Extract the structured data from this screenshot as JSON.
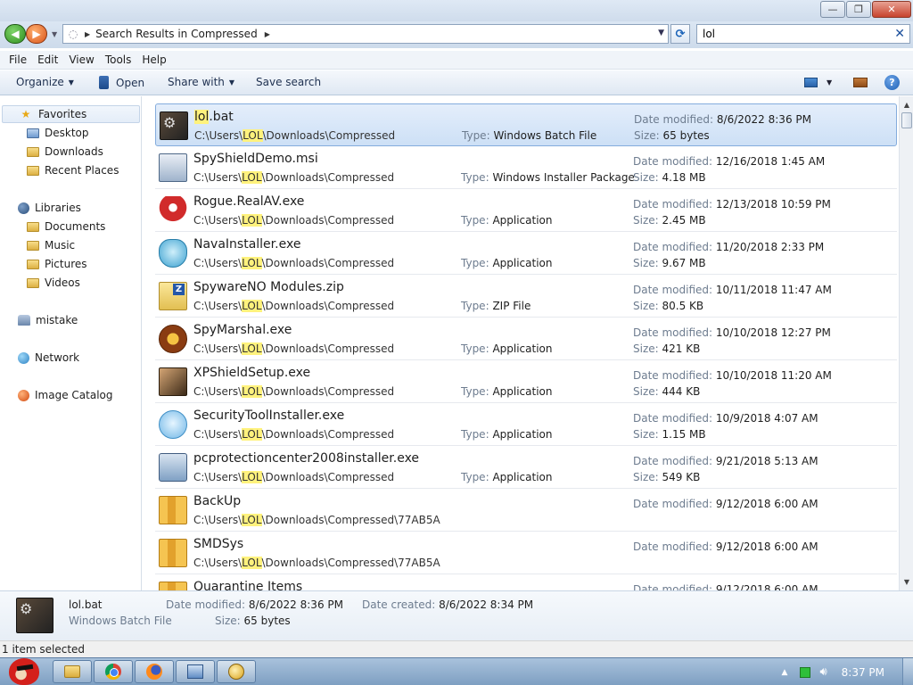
{
  "address": {
    "breadcrumb": "Search Results in Compressed"
  },
  "search": {
    "value": "lol"
  },
  "menu": {
    "items": [
      "File",
      "Edit",
      "View",
      "Tools",
      "Help"
    ]
  },
  "toolbar": {
    "organize": "Organize",
    "open": "Open",
    "share_with": "Share with",
    "save_search": "Save search"
  },
  "nav": {
    "favorites": "Favorites",
    "desktop": "Desktop",
    "downloads": "Downloads",
    "recent_places": "Recent Places",
    "libraries": "Libraries",
    "documents": "Documents",
    "music": "Music",
    "pictures": "Pictures",
    "videos": "Videos",
    "user": "mistake",
    "network": "Network",
    "image_catalog": "Image Catalog"
  },
  "labels": {
    "date_modified": "Date modified:",
    "size": "Size:",
    "type": "Type:",
    "date_created": "Date created:"
  },
  "files": [
    {
      "name_pre": "",
      "name_hl": "lol",
      "name_post": ".bat",
      "path_pre": "C:\\Users\\",
      "path_hl": "LOL",
      "path_post": "\\Downloads\\Compressed",
      "type": "Windows Batch File",
      "date": "8/6/2022 8:36 PM",
      "size": "65 bytes",
      "icon": "batch-file-icon",
      "selected": true
    },
    {
      "name_pre": "SpyShieldDemo.msi",
      "name_hl": "",
      "name_post": "",
      "path_pre": "C:\\Users\\",
      "path_hl": "LOL",
      "path_post": "\\Downloads\\Compressed",
      "type": "Windows Installer Package",
      "date": "12/16/2018 1:45 AM",
      "size": "4.18 MB",
      "icon": "installer-package-icon"
    },
    {
      "name_pre": "Rogue.RealAV.exe",
      "name_hl": "",
      "name_post": "",
      "path_pre": "C:\\Users\\",
      "path_hl": "LOL",
      "path_post": "\\Downloads\\Compressed",
      "type": "Application",
      "date": "12/13/2018 10:59 PM",
      "size": "2.45 MB",
      "icon": "umbrella-icon"
    },
    {
      "name_pre": "NavaInstaller.exe",
      "name_hl": "",
      "name_post": "",
      "path_pre": "C:\\Users\\",
      "path_hl": "LOL",
      "path_post": "\\Downloads\\Compressed",
      "type": "Application",
      "date": "11/20/2018 2:33 PM",
      "size": "9.67 MB",
      "icon": "shield-icon"
    },
    {
      "name_pre": "SpywareNO Modules.zip",
      "name_hl": "",
      "name_post": "",
      "path_pre": "C:\\Users\\",
      "path_hl": "LOL",
      "path_post": "\\Downloads\\Compressed",
      "type": "ZIP File",
      "date": "10/11/2018 11:47 AM",
      "size": "80.5 KB",
      "icon": "zip-folder-icon"
    },
    {
      "name_pre": "SpyMarshal.exe",
      "name_hl": "",
      "name_post": "",
      "path_pre": "C:\\Users\\",
      "path_hl": "LOL",
      "path_post": "\\Downloads\\Compressed",
      "type": "Application",
      "date": "10/10/2018 12:27 PM",
      "size": "421 KB",
      "icon": "marshal-badge-icon"
    },
    {
      "name_pre": "XPShieldSetup.exe",
      "name_hl": "",
      "name_post": "",
      "path_pre": "C:\\Users\\",
      "path_hl": "LOL",
      "path_post": "\\Downloads\\Compressed",
      "type": "Application",
      "date": "10/10/2018 11:20 AM",
      "size": "444 KB",
      "icon": "application-icon"
    },
    {
      "name_pre": "SecurityToolInstaller.exe",
      "name_hl": "",
      "name_post": "",
      "path_pre": "C:\\Users\\",
      "path_hl": "LOL",
      "path_post": "\\Downloads\\Compressed",
      "type": "Application",
      "date": "10/9/2018 4:07 AM",
      "size": "1.15 MB",
      "icon": "security-shield-icon"
    },
    {
      "name_pre": "pcprotectioncenter2008installer.exe",
      "name_hl": "",
      "name_post": "",
      "path_pre": "C:\\Users\\",
      "path_hl": "LOL",
      "path_post": "\\Downloads\\Compressed",
      "type": "Application",
      "date": "9/21/2018 5:13 AM",
      "size": "549 KB",
      "icon": "pc-installer-icon"
    },
    {
      "name_pre": "BackUp",
      "name_hl": "",
      "name_post": "",
      "path_pre": "C:\\Users\\",
      "path_hl": "LOL",
      "path_post": "\\Downloads\\Compressed\\77AB5A",
      "type": "",
      "date": "9/12/2018 6:00 AM",
      "size": "",
      "icon": "folder-icon"
    },
    {
      "name_pre": "SMDSys",
      "name_hl": "",
      "name_post": "",
      "path_pre": "C:\\Users\\",
      "path_hl": "LOL",
      "path_post": "\\Downloads\\Compressed\\77AB5A",
      "type": "",
      "date": "9/12/2018 6:00 AM",
      "size": "",
      "icon": "folder-icon"
    },
    {
      "name_pre": "Quarantine Items",
      "name_hl": "",
      "name_post": "",
      "path_pre": "",
      "path_hl": "",
      "path_post": "",
      "type": "",
      "date": "9/12/2018 6:00 AM",
      "size": "",
      "icon": "folder-icon"
    }
  ],
  "details": {
    "name": "lol.bat",
    "type": "Windows Batch File",
    "date_modified": "8/6/2022 8:36 PM",
    "date_created": "8/6/2022 8:34 PM",
    "size": "65 bytes"
  },
  "status": {
    "text": "1 item selected"
  },
  "taskbar": {
    "clock": "8:37 PM"
  }
}
